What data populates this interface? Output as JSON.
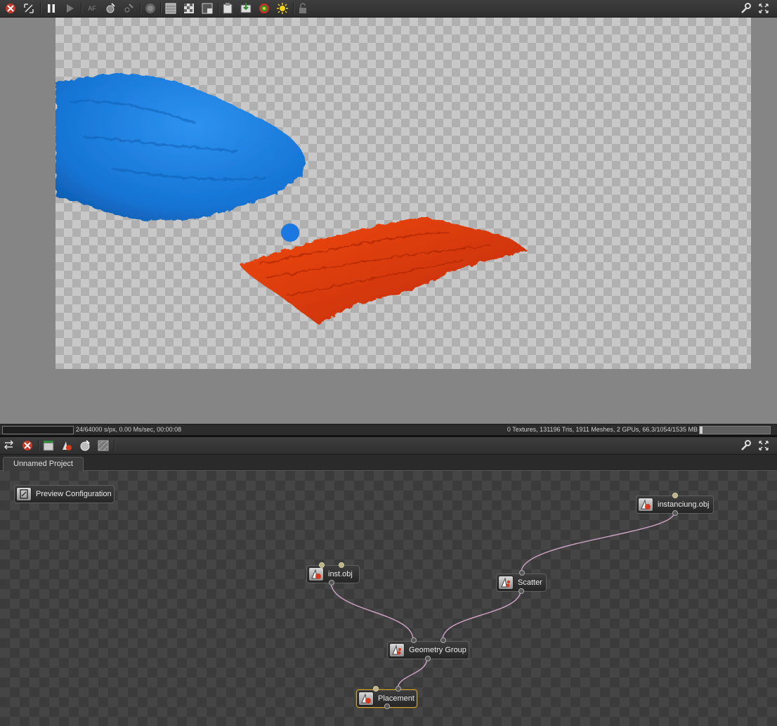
{
  "viewer": {
    "toolbar": {
      "buttons": [
        "cancel-render-icon",
        "fit-view-icon",
        "pause-icon",
        "play-icon",
        "af-focus-icon",
        "pick-material-icon",
        "pick-object-icon",
        "render-region-icon",
        "alpha-checker-icon",
        "checkerboard-icon",
        "background-icon",
        "clipboard-icon",
        "save-render-icon",
        "color-wheel-icon",
        "light-icon",
        "lock-icon"
      ],
      "af_label": "AF"
    },
    "status_left": "24/64000 s/px, 0.00 Ms/sec, 00:00:08",
    "status_right": "0 Textures, 131196 Tris, 1911 Meshes, 2 GPUs, 66.3/1054/1535 MB",
    "progress": 0.0,
    "memory_usage": 0.04
  },
  "graph_panel": {
    "toolbar_buttons": [
      "tab-settings-icon",
      "stop-icon",
      "scene-icon",
      "material-icon",
      "render-target-icon",
      "texture-icon"
    ],
    "tab_label": "Unnamed Project",
    "nodes": {
      "preview": "Preview Configuration",
      "instanciung": "instanciung.obj",
      "inst": "inst.obj",
      "scatter": "Scatter",
      "geometry_group": "Geometry Group",
      "placement": "Placement"
    }
  },
  "colors": {
    "fluid": "#1878d8",
    "terrain": "#e03a0c",
    "wire": "#c8a0c0",
    "selected_border": "#c9a64a"
  }
}
